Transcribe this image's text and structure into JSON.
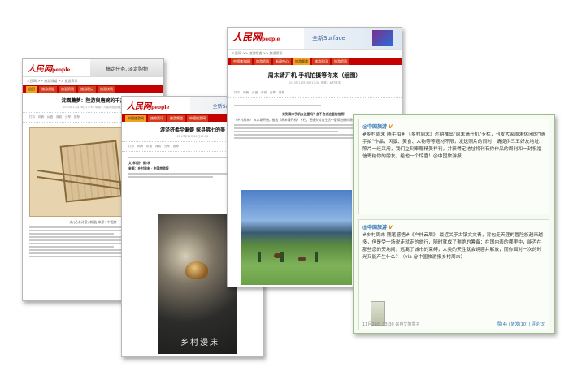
{
  "shot_a": {
    "logo": "人民网",
    "logo_sub": "people",
    "banner": "搞定任务, 淡定购物",
    "nav": [
      "首页",
      "旅游频道",
      "旅游资讯",
      "旅游观点",
      "旅游快讯"
    ],
    "crumb": "人民网 >> 旅游频道 >> 旅游资讯",
    "title": "沈園薦夢：陸游與唐婉的千古",
    "meta": "2013年11月28日13:38    来源：人民网旅游频道",
    "tools": [
      "打印",
      "网摘",
      "纠错",
      "商城",
      "分享",
      "推荐"
    ],
    "caption": "文/(乙未诗意)[前缀] 来源：中国旅"
  },
  "shot_b": {
    "logo": "人民网",
    "logo_sub": "people",
    "banner": "全新Surface",
    "nav": [
      "中国旅游网",
      "旅游资讯",
      "旅游频道",
      "中国旅游网"
    ],
    "title": "游泾挤柔至偏僻 探寻佛七的美",
    "meta": "2013年11月28日13:38",
    "tools": [
      "打印",
      "网摘",
      "纠错",
      "商城",
      "分享",
      "推荐"
    ],
    "line1": "文/孝相竹 摘/李",
    "line2": "来源：乡村周末 · 中国旅游报",
    "photo_caption": "乡村漫床"
  },
  "shot_c": {
    "logo": "人民网",
    "logo_sub": "people",
    "banner": "全新Surface",
    "nav": [
      "中国旅游网",
      "旅游资讯",
      "新闻中心",
      "旅游频道",
      "旅游资讯",
      "旅游资讯"
    ],
    "crumb": "人民网 >> 旅游频道 >> 旅游资讯",
    "title": "周末请开机 手机拍摄等你来（组图）",
    "meta": "2013年11月28日13:38    来源：乡村周末",
    "tools": [
      "打印",
      "网摘",
      "纠错",
      "商城",
      "分享",
      "推荐"
    ],
    "question": "来到周末手机去这里吗？会不会去这里的拍照？",
    "para": "《乡村周末》 从本期开始，推出《周末请开机》专栏，把镜头对准生活中值得拍摄的场景。"
  },
  "shot_d": {
    "post1": {
      "author": "@中国旅游",
      "badge": "V",
      "text": "#乡村周末 随手拍# 《乡村周末》近期推出\"周末请开机\"专栏，刊发大家周末休闲的\"随手拍\"作品，风景、美食、人物等等题材不限，发送照片的同时，请提供三五好友地址、照片一经采用，我们立刻奉赠精美样刊，并获得定地址将刊有你作品的周刊和一封祝福信寄给你的朋友，给他一个惊喜！@中国旅游报"
    },
    "post2": {
      "author": "@中国旅游",
      "badge": "V",
      "text": "#乡村周末 随笔感悟#《户外云周》 最近关于古镇文文青，背包走天涯的冒险族越来越多，但是受一场说走就走的旅行，随时就成了谢绝的筹备；在国内表的哪里中，能否在那些您的天地间，远离了城市的束缚，人类的天性就会诱惑并解放，而你面对一次的时光又能产生什么？（via @中国旅游报乡村周末）",
      "time": "11月29日 13:30",
      "source": "来自艾简盒子",
      "likes": "赞(4)",
      "repost": "转发(10)",
      "comments": "评论(3)"
    }
  }
}
